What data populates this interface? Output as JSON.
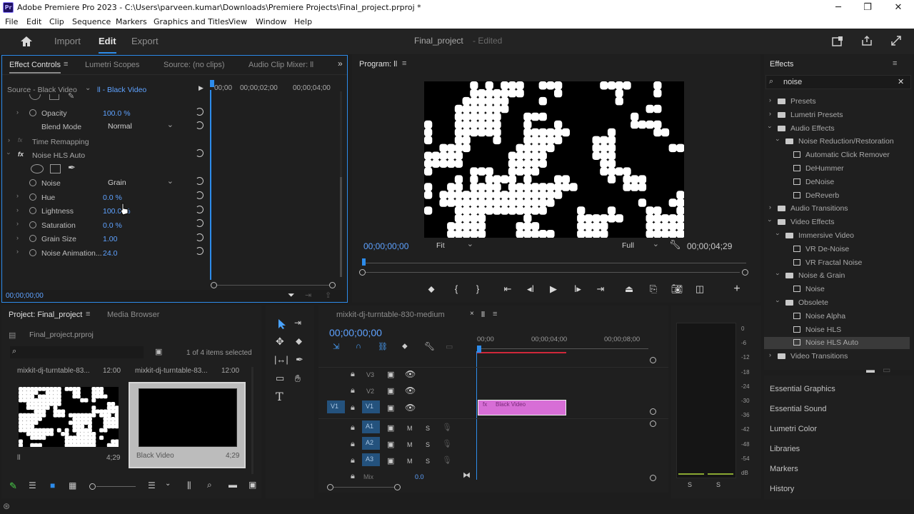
{
  "window": {
    "title": "Adobe Premiere Pro 2023 - C:\\Users\\parveen.kumar\\Downloads\\Premiere Projects\\Final_project.prproj *",
    "app_icon": "Pr",
    "controls": [
      "minimize-icon",
      "maximize-icon",
      "close-icon"
    ]
  },
  "menu": [
    "File",
    "Edit",
    "Clip",
    "Sequence",
    "Markers",
    "Graphics and Titles",
    "View",
    "Window",
    "Help"
  ],
  "header": {
    "tabs": [
      "Import",
      "Edit",
      "Export"
    ],
    "active_tab": "Edit",
    "project_name": "Final_project",
    "status": "- Edited"
  },
  "effect_controls": {
    "tabs": [
      "Effect Controls",
      "Lumetri Scopes",
      "Source: (no clips)",
      "Audio Clip Mixer: ll"
    ],
    "source_label": "Source - Black Video",
    "clip_label": "ll - Black Video",
    "ruler": [
      "00;00",
      "00;00;02;00",
      "00;00;04;00"
    ],
    "opacity": {
      "label": "Opacity",
      "value": "100.0 %"
    },
    "blend_mode": {
      "label": "Blend Mode",
      "value": "Normal"
    },
    "time_remapping": "Time Remapping",
    "effect_name": "Noise HLS Auto",
    "params": [
      {
        "label": "Noise",
        "value": "Grain",
        "type": "dropdown"
      },
      {
        "label": "Hue",
        "value": "0.0 %"
      },
      {
        "label": "Lightness",
        "value": "100.0 %"
      },
      {
        "label": "Saturation",
        "value": "0.0 %"
      },
      {
        "label": "Grain Size",
        "value": "1.00"
      },
      {
        "label": "Noise Animation...",
        "value": "24.0"
      }
    ],
    "timecode": "00;00;00;00"
  },
  "program": {
    "title": "Program: ll",
    "timecode": "00;00;00;00",
    "fit": "Fit",
    "quality": "Full",
    "duration": "00;00;04;29"
  },
  "effects_panel": {
    "title": "Effects",
    "search_value": "noise",
    "tree": [
      {
        "label": "Presets",
        "level": 0,
        "type": "folder"
      },
      {
        "label": "Lumetri Presets",
        "level": 0,
        "type": "folder"
      },
      {
        "label": "Audio Effects",
        "level": 0,
        "type": "folder",
        "open": true
      },
      {
        "label": "Noise Reduction/Restoration",
        "level": 1,
        "type": "folder",
        "open": true
      },
      {
        "label": "Automatic Click Remover",
        "level": 2,
        "type": "effect"
      },
      {
        "label": "DeHummer",
        "level": 2,
        "type": "effect"
      },
      {
        "label": "DeNoise",
        "level": 2,
        "type": "effect"
      },
      {
        "label": "DeReverb",
        "level": 2,
        "type": "effect"
      },
      {
        "label": "Audio Transitions",
        "level": 0,
        "type": "folder"
      },
      {
        "label": "Video Effects",
        "level": 0,
        "type": "folder",
        "open": true
      },
      {
        "label": "Immersive Video",
        "level": 1,
        "type": "folder",
        "open": true
      },
      {
        "label": "VR De-Noise",
        "level": 2,
        "type": "effect"
      },
      {
        "label": "VR Fractal Noise",
        "level": 2,
        "type": "effect"
      },
      {
        "label": "Noise & Grain",
        "level": 1,
        "type": "folder",
        "open": true
      },
      {
        "label": "Noise",
        "level": 2,
        "type": "effect"
      },
      {
        "label": "Obsolete",
        "level": 1,
        "type": "folder",
        "open": true
      },
      {
        "label": "Noise Alpha",
        "level": 2,
        "type": "effect"
      },
      {
        "label": "Noise HLS",
        "level": 2,
        "type": "effect"
      },
      {
        "label": "Noise HLS Auto",
        "level": 2,
        "type": "effect",
        "selected": true
      },
      {
        "label": "Video Transitions",
        "level": 0,
        "type": "folder"
      }
    ],
    "lower_panels": [
      "Essential Graphics",
      "Essential Sound",
      "Lumetri Color",
      "Libraries",
      "Markers",
      "History"
    ]
  },
  "project_panel": {
    "tabs": [
      "Project: Final_project",
      "Media Browser"
    ],
    "file": "Final_project.prproj",
    "count": "1 of 4 items selected",
    "items": [
      {
        "name": "mixkit-dj-turntable-83...",
        "duration": "12:00",
        "label": "ll",
        "time": "4;29"
      },
      {
        "name": "mixkit-dj-turntable-83...",
        "duration": "12:00",
        "label": "Black Video",
        "time": "4;29"
      }
    ]
  },
  "timeline": {
    "tab": "mixkit-dj-turntable-830-medium",
    "sequence": "ll",
    "timecode": "00;00;00;00",
    "ruler": [
      "00;00",
      "00;00;04;00",
      "00;00;08;00"
    ],
    "tracks_video": [
      "V3",
      "V2",
      "V1"
    ],
    "source_patch": "V1",
    "tracks_audio": [
      "A1",
      "A2",
      "A3"
    ],
    "mix_label": "Mix",
    "mix_value": "0.0",
    "clip": "Black Video",
    "audio_buttons": [
      "M",
      "S"
    ]
  },
  "audio_meter": {
    "scale": [
      "0",
      "-6",
      "-12",
      "-18",
      "-24",
      "-30",
      "-36",
      "-42",
      "-48",
      "-54",
      "dB"
    ],
    "solo": [
      "S",
      "S"
    ]
  },
  "colors": {
    "accent": "#2d8ceb",
    "clip": "#d76ed6",
    "work_area": "#d0283a",
    "link": "#5ea2ff"
  }
}
